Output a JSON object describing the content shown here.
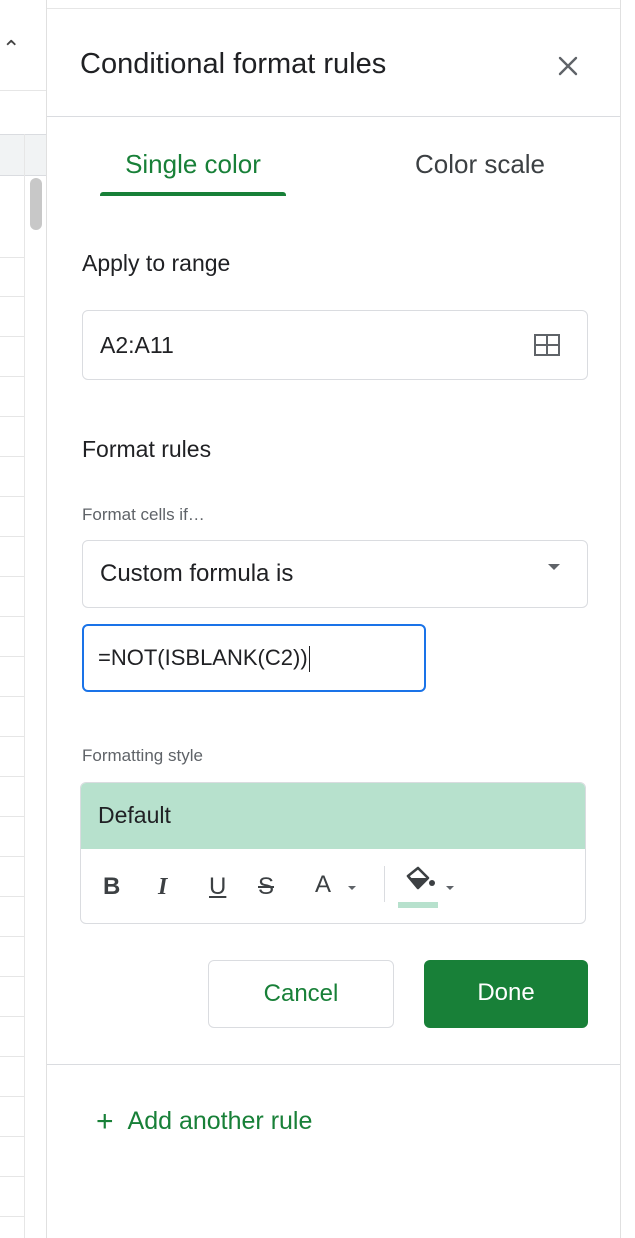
{
  "panel": {
    "title": "Conditional format rules",
    "close_icon": "close-icon"
  },
  "tabs": [
    {
      "label": "Single color",
      "active": true
    },
    {
      "label": "Color scale",
      "active": false
    }
  ],
  "apply_to_range": {
    "label": "Apply to range",
    "value": "A2:A11",
    "icon": "grid-select-icon"
  },
  "format_rules": {
    "label": "Format rules",
    "condition_label": "Format cells if…",
    "condition_value": "Custom formula is",
    "formula_value": "=NOT(ISBLANK(C2))"
  },
  "formatting_style": {
    "label": "Formatting style",
    "preview_text": "Default",
    "preview_color": "#b7e1cd",
    "tools": {
      "bold": "B",
      "italic": "I",
      "underline": "U",
      "strikethrough": "S",
      "text_color": "A"
    },
    "fill_icon": "fill-color-icon"
  },
  "actions": {
    "cancel_label": "Cancel",
    "done_label": "Done"
  },
  "add_rule": {
    "label": "Add another rule",
    "icon": "+"
  },
  "colors": {
    "accent": "#188038",
    "focus": "#1a73e8"
  }
}
